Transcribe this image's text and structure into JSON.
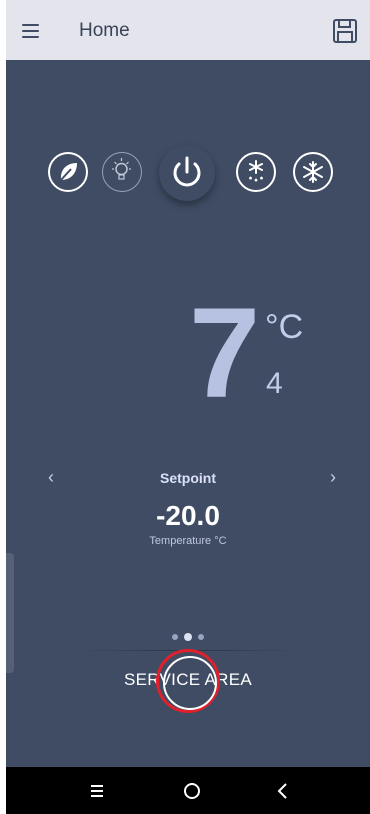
{
  "app_bar": {
    "title": "Home"
  },
  "icons": {
    "menu": "hamburger-menu-icon",
    "save": "floppy-disk-icon",
    "modes": [
      "leaf-eco-icon",
      "light-bulb-icon",
      "power-icon",
      "defrost-snowflake-drop-icon",
      "fast-freeze-snowflake-icon"
    ]
  },
  "display": {
    "temperature": "7",
    "unit": "°C",
    "secondary": "4"
  },
  "setpoint": {
    "prev_arrow": "‹",
    "next_arrow": "›",
    "label": "Setpoint",
    "value": "-20.0",
    "sub_label": "Temperature °C"
  },
  "pager": {
    "pages": 3,
    "active_index": 1
  },
  "service": {
    "label": "SERVICE AREA"
  },
  "navbar": {
    "recent": "≡",
    "home": "○",
    "back": "‹"
  },
  "colors": {
    "background": "#3f4c64",
    "appbar": "#e3e4ec",
    "big_temp": "#b7c1e1",
    "tap_marker": "#e0202a"
  }
}
